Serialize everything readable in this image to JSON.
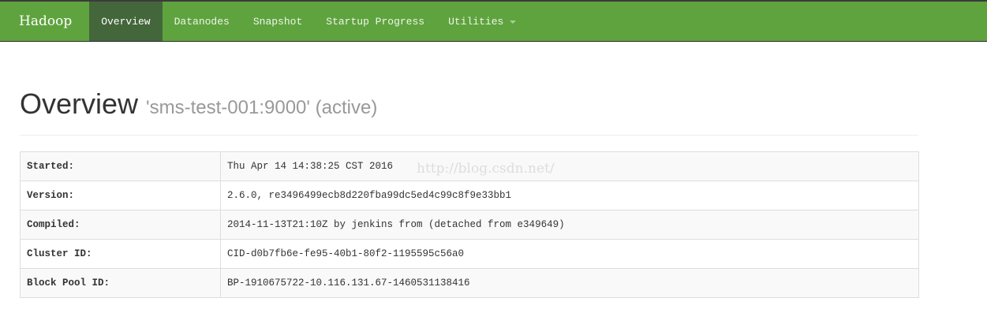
{
  "navbar": {
    "brand": "Hadoop",
    "items": [
      {
        "label": "Overview",
        "active": true
      },
      {
        "label": "Datanodes"
      },
      {
        "label": "Snapshot"
      },
      {
        "label": "Startup Progress"
      },
      {
        "label": "Utilities",
        "dropdown": true
      }
    ]
  },
  "header": {
    "title": "Overview",
    "subtitle": "'sms-test-001:9000' (active)"
  },
  "table": [
    {
      "key": "Started:",
      "value": "Thu Apr 14 14:38:25 CST 2016"
    },
    {
      "key": "Version:",
      "value": "2.6.0, re3496499ecb8d220fba99dc5ed4c99c8f9e33bb1"
    },
    {
      "key": "Compiled:",
      "value": "2014-11-13T21:10Z by jenkins from (detached from e349649)"
    },
    {
      "key": "Cluster ID:",
      "value": "CID-d0b7fb6e-fe95-40b1-80f2-1195595c56a0"
    },
    {
      "key": "Block Pool ID:",
      "value": "BP-1910675722-10.116.131.67-1460531138416"
    }
  ],
  "watermark": "http://blog.csdn.net/",
  "colors": {
    "navbar": "#5fa33e",
    "active": "#43663a"
  }
}
